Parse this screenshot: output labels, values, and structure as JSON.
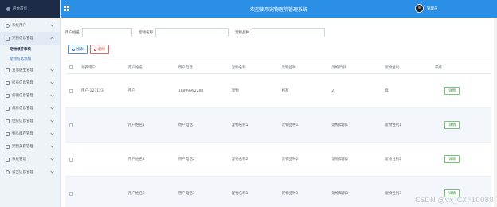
{
  "sidebar": {
    "brand": "后台首页",
    "items": [
      {
        "label": "系统用户",
        "icon": "user-icon"
      },
      {
        "label": "宠物信息管理",
        "icon": "box-icon",
        "open": true
      },
      {
        "label": "宠物领养审核",
        "sub": true,
        "active": true
      },
      {
        "label": "宠物信息添加",
        "sub": true
      },
      {
        "label": "宣示医生管理",
        "icon": "box-icon"
      },
      {
        "label": "挂号信息管理",
        "icon": "box-icon"
      },
      {
        "label": "病例信息管理",
        "icon": "box-icon"
      },
      {
        "label": "病房信息管理",
        "icon": "box-icon"
      },
      {
        "label": "住院信息管理",
        "icon": "box-icon"
      },
      {
        "label": "物品库存管理",
        "icon": "box-icon"
      },
      {
        "label": "宠物美容管理",
        "icon": "box-icon"
      },
      {
        "label": "系统管理",
        "icon": "grid-icon"
      },
      {
        "label": "公告信息管理",
        "icon": "circle-icon"
      }
    ]
  },
  "header": {
    "title": "欢迎使用宠物医院管理系统",
    "user": "管理员"
  },
  "search": {
    "label1": "用户姓名",
    "label2": "宠物名称",
    "label3": "宠物品种",
    "search_btn": "搜索",
    "delete_btn": "删除"
  },
  "table": {
    "headers": [
      "",
      "领养用户",
      "用户姓名",
      "用户电话",
      "宠物名称",
      "宠物品种",
      "宠物年龄",
      "宠物性别",
      "操作"
    ],
    "rows": [
      [
        "",
        "用户-123123",
        "用户",
        "18899992280",
        "宠物",
        "柯基",
        "2",
        "母",
        "详情"
      ],
      [
        "",
        "",
        "用户姓名1",
        "用户电话1",
        "宠物名称1",
        "宠物品种1",
        "宠物年龄1",
        "宠物性别1",
        "详情"
      ],
      [
        "",
        "",
        "用户姓名2",
        "用户电话2",
        "宠物名称2",
        "宠物品种2",
        "宠物年龄2",
        "宠物性别2",
        "详情"
      ],
      [
        "",
        "",
        "用户姓名3",
        "用户电话3",
        "宠物名称3",
        "宠物品种3",
        "宠物年龄3",
        "宠物性别3",
        "详情"
      ]
    ]
  },
  "watermark": "CSDN @vx_CXF10088",
  "colors": {
    "header": "#2c8fe6",
    "sidebar": "#eef3f8",
    "sidebar_header": "#1d2b46"
  }
}
